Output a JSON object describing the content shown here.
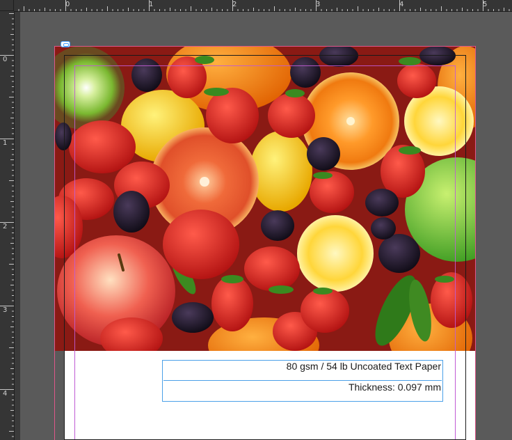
{
  "ruler": {
    "top_labels": [
      "0",
      "1",
      "2",
      "3",
      "4",
      "5"
    ],
    "left_labels": [
      "0",
      "1",
      "2",
      "3",
      "4"
    ]
  },
  "image": {
    "icon": "fruit-photo"
  },
  "text_frame": {
    "line1": "80 gsm / 54 lb Uncoated Text Paper",
    "line2": "Thickness: 0.097 mm"
  },
  "colors": {
    "pasteboard": "#5a5a5a",
    "ruler": "#353535",
    "bleed": "#e0578a",
    "margin": "#c05bd4",
    "frame_selection": "#4aa0e8"
  }
}
